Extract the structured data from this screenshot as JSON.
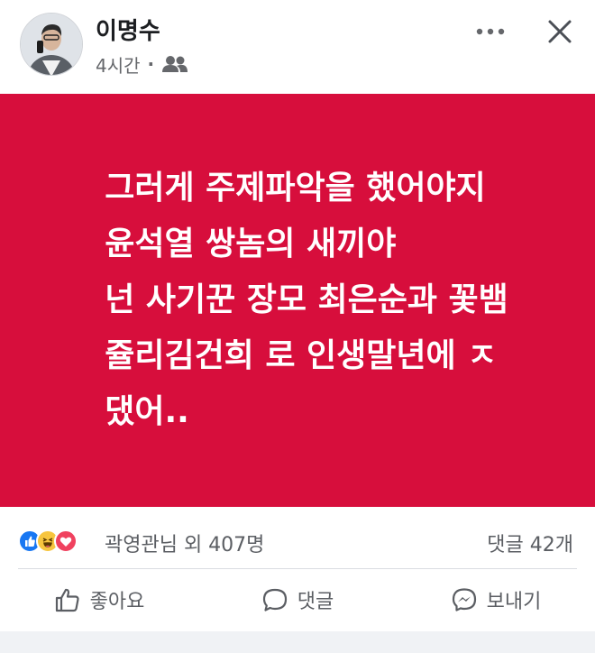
{
  "post": {
    "author": "이명수",
    "time": "4시간",
    "separator": "·",
    "privacy_icon": "friends-icon",
    "text_lines": [
      "그러게 주제파악을 했어야지",
      "윤석열 쌍놈의 새끼야",
      "넌 사기꾼 장모 최은순과 꽃뱀",
      "쥴리김건희 로 인생말년에 ㅈ",
      "댔어.."
    ],
    "background_color": "#d70e3c"
  },
  "reactions": {
    "icons": [
      "like-icon",
      "haha-icon",
      "love-icon"
    ],
    "summary": "곽영관님 외 407명",
    "comments": "댓글 42개"
  },
  "actions": {
    "like": "좋아요",
    "comment": "댓글",
    "share": "보내기"
  }
}
